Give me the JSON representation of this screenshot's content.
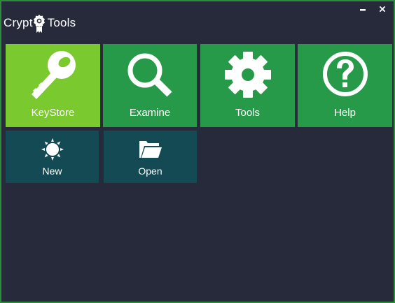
{
  "app": {
    "title_left": "Crypt",
    "title_right": "Tools",
    "logo_icon": "award-ribbon-icon",
    "border_color": "#2e8b3c",
    "background_color": "#272a3a"
  },
  "window_controls": {
    "minimize_icon": "minimize-icon",
    "close_icon": "close-icon"
  },
  "tiles": {
    "keystore": {
      "label": "KeyStore",
      "icon": "key-icon",
      "color": "#7ac92e"
    },
    "examine": {
      "label": "Examine",
      "icon": "magnifier-icon",
      "color": "#279a49"
    },
    "tools": {
      "label": "Tools",
      "icon": "gear-icon",
      "color": "#279a49"
    },
    "help": {
      "label": "Help",
      "icon": "question-circle-icon",
      "color": "#279a49"
    },
    "new": {
      "label": "New",
      "icon": "sun-burst-icon",
      "color": "#144a54"
    },
    "open": {
      "label": "Open",
      "icon": "folder-open-icon",
      "color": "#144a54"
    }
  }
}
